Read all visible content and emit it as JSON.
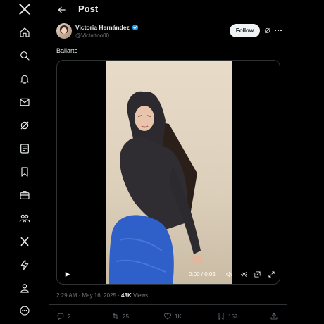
{
  "header": {
    "title": "Post",
    "back_icon": "arrow-left-icon"
  },
  "sidebar": {
    "items": [
      {
        "name": "x-logo-icon"
      },
      {
        "name": "home-icon"
      },
      {
        "name": "explore-search-icon"
      },
      {
        "name": "notifications-bell-icon"
      },
      {
        "name": "messages-mail-icon"
      },
      {
        "name": "grok-icon"
      },
      {
        "name": "lists-icon"
      },
      {
        "name": "bookmarks-icon"
      },
      {
        "name": "jobs-briefcase-icon"
      },
      {
        "name": "communities-icon"
      },
      {
        "name": "premium-x-icon"
      },
      {
        "name": "verified-orgs-bolt-icon"
      },
      {
        "name": "profile-icon"
      },
      {
        "name": "more-circle-icon"
      }
    ]
  },
  "post": {
    "author_name": "Victoria Hernández",
    "handle": "@Victattoo00",
    "follow_label": "Follow",
    "text": "Bailarte",
    "video": {
      "time": "0:00 / 0:05",
      "progress": 0.0
    },
    "timestamp": "2:29 AM · May 16, 2025 · ",
    "views_count": "43K",
    "views_label": " Views",
    "actions": {
      "replies": "2",
      "reposts": "25",
      "likes": "1K",
      "bookmarks": "157"
    }
  },
  "colors": {
    "background": "#000000",
    "text_primary": "#e7e9ea",
    "text_secondary": "#71767b",
    "verified_blue": "#1d9bf0",
    "border": "#2f3336"
  }
}
